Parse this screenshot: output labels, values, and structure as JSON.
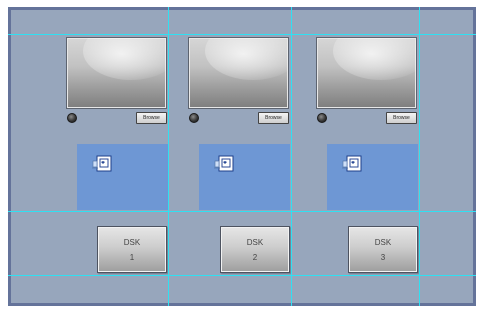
{
  "slots": [
    {
      "browse_label": "Browse",
      "dsk_label": "DSK",
      "dsk_number": "1"
    },
    {
      "browse_label": "Browse",
      "dsk_label": "DSK",
      "dsk_number": "2"
    },
    {
      "browse_label": "Browse",
      "dsk_label": "DSK",
      "dsk_number": "3"
    }
  ],
  "icons": {
    "preview_status": "led-indicator-icon",
    "drop_zone": "image-document-icon"
  },
  "colors": {
    "panel_background": "#97a6bc",
    "panel_border": "#64739a",
    "guide_lines": "#2fe0f2",
    "drop_zone": "#6e97d4"
  }
}
